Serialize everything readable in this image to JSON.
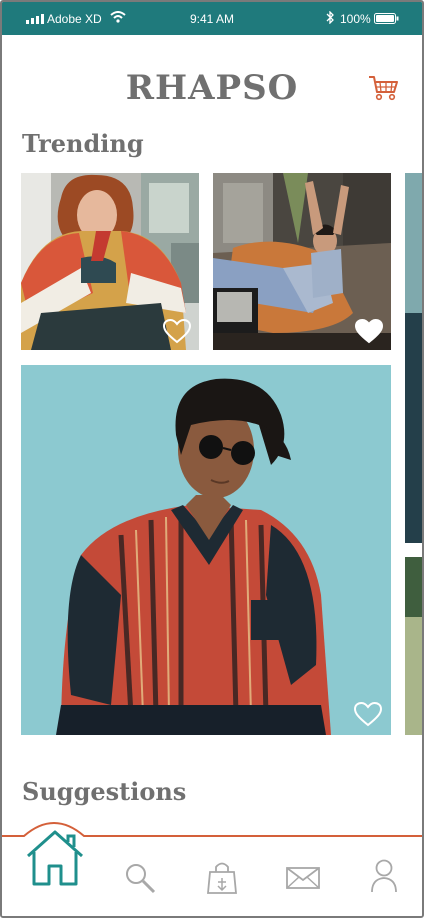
{
  "status_bar": {
    "carrier": "Adobe XD",
    "time": "9:41 AM",
    "battery_percent": "100%"
  },
  "header": {
    "title": "RHAPSO"
  },
  "sections": {
    "trending": "Trending",
    "suggestions": "Suggestions"
  },
  "trending_cards": [
    {
      "favorited": false
    },
    {
      "favorited": true
    },
    {
      "favorited": false
    }
  ],
  "nav": {
    "active": "home",
    "items": [
      "home",
      "search",
      "shop",
      "messages",
      "profile"
    ]
  },
  "colors": {
    "brand_teal": "#1f7a7c",
    "accent_orange": "#d4603a",
    "text_gray": "#707070",
    "icon_gray": "#a8a8a8"
  }
}
